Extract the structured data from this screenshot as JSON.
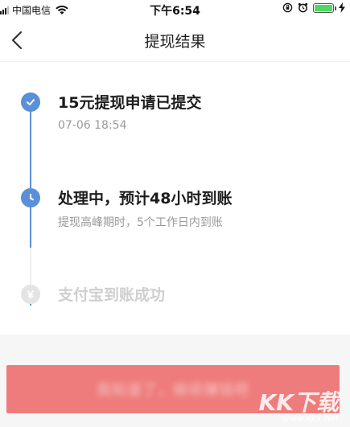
{
  "status_bar": {
    "carrier": "中国电信",
    "time": "下午6:54",
    "battery_level": 1.0
  },
  "nav": {
    "title": "提现结果"
  },
  "timeline": {
    "steps": [
      {
        "title": "15元提现申请已提交",
        "subtitle": "07-06 18:54",
        "state": "done",
        "icon": "check-icon"
      },
      {
        "title": "处理中，预计48小时到账",
        "subtitle": "提现高峰期时，5个工作日内到账",
        "state": "current",
        "icon": "clock-icon"
      },
      {
        "title": "支付宝到账成功",
        "subtitle": "",
        "state": "pending",
        "icon": "yuan-icon"
      }
    ]
  },
  "footer": {
    "button_label": "我知道了，继续赚钱吧"
  },
  "watermark": {
    "logo_text": "KK下载",
    "url": "www.kkx.net"
  },
  "colors": {
    "accent": "#5b8fd8",
    "button": "#ef7c7c",
    "muted": "#cfcfcf",
    "subtitle": "#9a9a9a"
  }
}
